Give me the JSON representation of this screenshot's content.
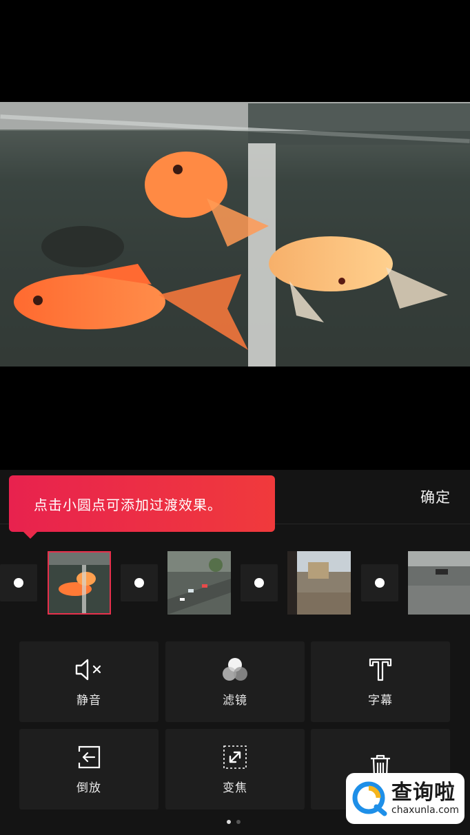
{
  "header": {
    "confirm_label": "确定"
  },
  "tooltip": {
    "text": "点击小圆点可添加过渡效果。"
  },
  "timeline": {
    "clips": [
      "goldfish-clip",
      "street-traffic-clip",
      "window-view-clip",
      "plaza-clip"
    ],
    "selected_index": 0
  },
  "tools": {
    "mute": "静音",
    "filter": "滤镜",
    "subtitle": "字幕",
    "reverse": "倒放",
    "zoom": "变焦",
    "delete": ""
  },
  "pager": {
    "pages": 2,
    "current": 1
  },
  "watermark": {
    "cn": "查询啦",
    "en": "chaxunla.com"
  },
  "colors": {
    "accent": "#e8304c",
    "panel": "#141414",
    "tile": "#1e1e1e"
  }
}
